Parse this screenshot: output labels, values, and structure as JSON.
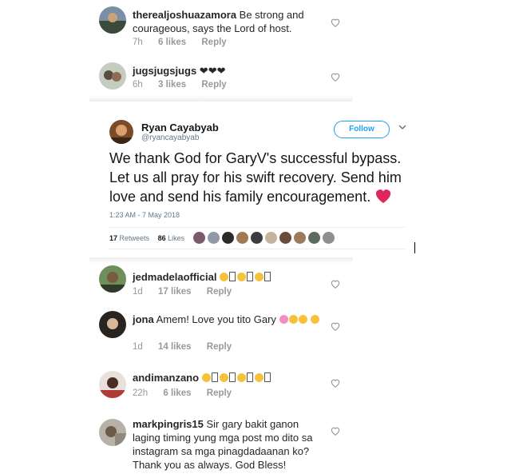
{
  "comments_top": [
    {
      "username": "therealjoshuazamora",
      "text": "Be strong and courageous, says the Lord of host.",
      "time": "7h",
      "likes": "6 likes",
      "reply": "Reply"
    },
    {
      "username": "jugsjugsjugs",
      "text": "❤❤❤",
      "time": "6h",
      "likes": "3 likes",
      "reply": "Reply"
    }
  ],
  "tweet": {
    "name": "Ryan Cayabyab",
    "handle": "@ryancayabyab",
    "follow_label": "Follow",
    "text": "We thank God for GaryV's successful bypass. Let us all pray for his swift recovery. Send him love and send his family encouragement.",
    "timestamp": "1:23 AM - 7 May 2018",
    "retweets_count": "17",
    "retweets_label": "Retweets",
    "likes_count": "86",
    "likes_label": "Likes",
    "colors": {
      "accent": "#1da1f2",
      "heart": "#e0245e"
    }
  },
  "comments_bottom": [
    {
      "username": "jedmadelaofficial",
      "time": "1d",
      "likes": "17 likes",
      "reply": "Reply"
    },
    {
      "username": "jona",
      "text": "Amem! Love you tito Gary",
      "time": "1d",
      "likes": "14 likes",
      "reply": "Reply"
    },
    {
      "username": "andimanzano",
      "time": "22h",
      "likes": "6 likes",
      "reply": "Reply"
    },
    {
      "username": "markpingris15",
      "text": "Sir gary bakit ganon laging timing yung mga post mo dito sa instagram sa mga pinagdadaanan ko? Thank you as always. God Bless!"
    }
  ],
  "icons": [
    "heart-outline-icon",
    "chevron-down-icon",
    "heart-emoji-icon"
  ]
}
